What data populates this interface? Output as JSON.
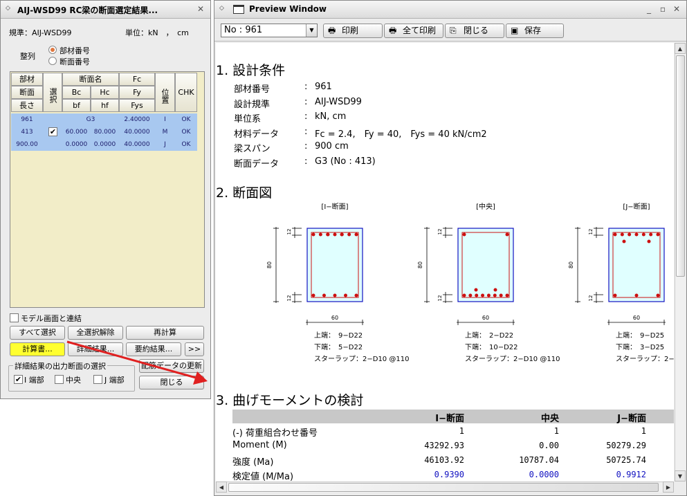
{
  "left_panel": {
    "title": "AIJ-WSD99 RC梁の断面選定結果...",
    "standard": "規準：AIJ-WSD99",
    "units": "単位：kN　，　cm",
    "sort_label": "整列",
    "sort_options": [
      "部材番号",
      "断面番号"
    ],
    "grid_headers": {
      "col1": [
        "部材",
        "断面",
        "長さ"
      ],
      "select": "選択",
      "sec_name": "断面名",
      "row2": [
        "Bc",
        "Hc"
      ],
      "row3": [
        "bf",
        "hf"
      ],
      "fc": [
        "Fc",
        "Fy",
        "Fys"
      ],
      "position": "位置",
      "chk": "CHK"
    },
    "grid_rows": [
      {
        "c1": "961",
        "sec": "G3",
        "fc": "2.40000",
        "pos": "I",
        "chk": "OK"
      },
      {
        "c1": "413",
        "bc": "60.000",
        "hc": "80.000",
        "fc": "40.0000",
        "pos": "M",
        "chk": "OK"
      },
      {
        "c1": "900.00",
        "bc": "0.0000",
        "hc": "0.0000",
        "fc": "40.0000",
        "pos": "J",
        "chk": "OK"
      }
    ],
    "link_model": "モデル画面と連結",
    "buttons": {
      "select_all": "すべて選択",
      "deselect_all": "全選択解除",
      "recalc": "再計算",
      "calc_report": "計算書...",
      "detail_result": "詳細結果...",
      "summary_result": "要約結果...",
      "more": ">>",
      "update_rebar": "配筋データの更新",
      "close": "閉じる"
    },
    "output_group": "詳細結果の出力断面の選択",
    "output_options": [
      "I 端部",
      "中央",
      "J 端部"
    ]
  },
  "preview": {
    "title": "Preview Window",
    "combo_value": "No : 961",
    "toolbar": {
      "print": "印刷",
      "print_all": "全て印刷",
      "close": "閉じる",
      "save": "保存"
    },
    "section1": {
      "heading": "1. 設計条件",
      "rows": [
        {
          "k": "部材番号",
          "v": "961"
        },
        {
          "k": "設計規準",
          "v": "AIJ-WSD99"
        },
        {
          "k": "単位系",
          "v": "kN, cm"
        },
        {
          "k": "材料データ",
          "v": "Fc = 2.4,　Fy = 40,　Fys = 40 kN/cm2"
        },
        {
          "k": "梁スパン",
          "v": "900 cm"
        },
        {
          "k": "断面データ",
          "v": "G3 (No : 413)"
        }
      ],
      "separator": ":"
    },
    "section2": {
      "heading": "2. 断面図",
      "sections": [
        {
          "title": "[I−断面]",
          "top": "上端：　9−D22",
          "bottom": "下端：　5−D22",
          "stirrup": "スターラップ：2−D10 @110"
        },
        {
          "title": "[中央]",
          "top": "上端：　2−D22",
          "bottom": "下端：　10−D22",
          "stirrup": "スターラップ：2−D10 @110"
        },
        {
          "title": "[J−断面]",
          "top": "上端：　9−D25",
          "bottom": "下端：　3−D25",
          "stirrup": "スターラップ：2−"
        }
      ],
      "dims": {
        "height": "80",
        "width": "60",
        "cover": "12"
      }
    },
    "section3": {
      "heading": "3. 曲げモーメントの検討",
      "columns": [
        "I−断面",
        "中央",
        "J−断面"
      ],
      "rows": [
        {
          "label": "(-) 荷重組合わせ番号",
          "values": [
            "1",
            "1",
            "1"
          ]
        },
        {
          "label": "Moment (M)",
          "values": [
            "43292.93",
            "0.00",
            "50279.29"
          ]
        },
        {
          "label": "強度 (Ma)",
          "values": [
            "46103.92",
            "10787.04",
            "50725.74"
          ]
        },
        {
          "label": "検定値 (M/Ma)",
          "values": [
            "0.9390",
            "0.0000",
            "0.9912"
          ]
        }
      ]
    }
  },
  "colors": {
    "highlight_row": "#a8c8f0",
    "yellow_button": "#ffff30",
    "arrow": "#e02020",
    "section_border": "#1010c0",
    "rebar": "#cc1010",
    "section_fill": "#e0ffff",
    "ratio_text": "#1010c0"
  }
}
